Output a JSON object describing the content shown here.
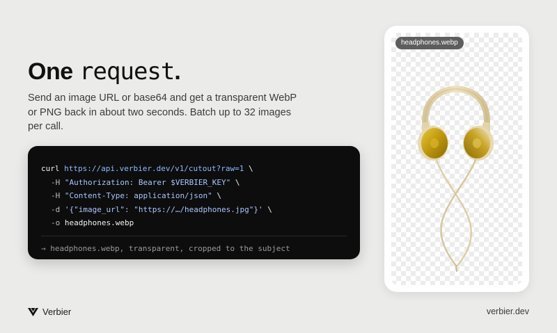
{
  "hero": {
    "headline_word1": "One",
    "headline_word2": "request",
    "headline_period": ".",
    "description": "Send an image URL or base64 and get a transparent WebP or PNG back in about two seconds. Batch up to 32 images per call."
  },
  "code": {
    "line1_cmd": "curl",
    "line1_url": "https://api.verbier.dev/v1/cutout?raw=1",
    "line1_cont": " \\",
    "line2_flag": "-H",
    "line2_value": "\"Authorization: Bearer $VERBIER_KEY\"",
    "line2_cont": " \\",
    "line3_flag": "-H",
    "line3_value": "\"Content-Type: application/json\"",
    "line3_cont": " \\",
    "line4_flag": "-d",
    "line4_value": "'{\"image_url\": \"https://…/headphones.jpg\"}'",
    "line4_cont": " \\",
    "line5_flag": "-o",
    "line5_value": "headphones.webp",
    "result": "→ headphones.webp, transparent, cropped to the subject"
  },
  "preview": {
    "file_name": "headphones.webp",
    "image_icon": "headphones-image"
  },
  "footer": {
    "brand_name": "Verbier",
    "brand_icon": "verbier-logo",
    "domain": "verbier.dev"
  },
  "colors": {
    "background": "#ebebea",
    "code_bg": "#0d0d0d",
    "code_url": "#8fb8ff",
    "chip_bg": "#5d5d5d"
  }
}
